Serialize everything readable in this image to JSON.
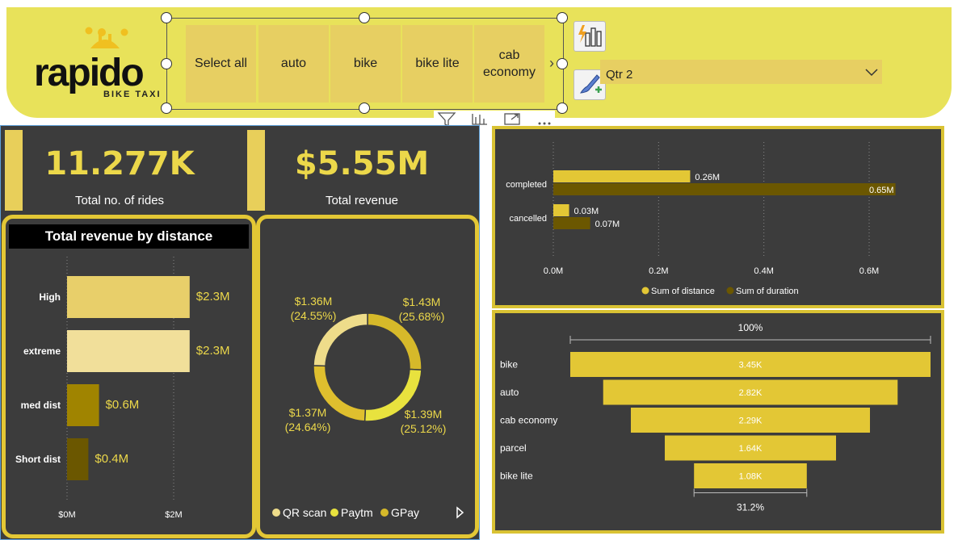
{
  "header": {
    "logo_text": "rapido",
    "logo_sub": "BIKE TAXI",
    "slicer_items": [
      "Select all",
      "auto",
      "bike",
      "bike lite",
      "cab economy"
    ],
    "quarter": "Qtr 2",
    "colors": {
      "header_bg": "#e8e25a",
      "tile": "#e7cf62"
    },
    "icons": [
      "quick-insights-icon",
      "format-painter-icon",
      "filter-icon",
      "focus-mode-icon",
      "expand-icon",
      "more-options-icon",
      "chevron-down-icon"
    ]
  },
  "cards": {
    "rides_value": "11.277K",
    "rides_label": "Total no. of rides",
    "revenue_value": "$5.55M",
    "revenue_label": "Total revenue"
  },
  "revenue_by_distance_title": "Total revenue by distance",
  "donut_legend": [
    "QR scan",
    "Paytm",
    "GPay"
  ],
  "chart_data": [
    {
      "type": "bar",
      "orientation": "horizontal",
      "title": "Total revenue by distance",
      "categories": [
        "High",
        "extreme",
        "med dist",
        "Short dist"
      ],
      "values": [
        2.3,
        2.3,
        0.6,
        0.4
      ],
      "value_labels": [
        "$2.3M",
        "$2.3M",
        "$0.6M",
        "$0.4M"
      ],
      "bar_colors": [
        "#e8cf6a",
        "#f1df9a",
        "#a08400",
        "#6b5700"
      ],
      "x_ticks": [
        "$0M",
        "$2M"
      ],
      "xlim": [
        0,
        2.6
      ],
      "grid": true
    },
    {
      "type": "pie",
      "donut": true,
      "labels": [
        "QR scan",
        "Paytm",
        "GPay"
      ],
      "segments": [
        {
          "value": 1.43,
          "label": "$1.43M",
          "pct": "(25.68%)",
          "color": "#d6b92a"
        },
        {
          "value": 1.39,
          "label": "$1.39M",
          "pct": "(25.12%)",
          "color": "#e8e23e"
        },
        {
          "value": 1.37,
          "label": "$1.37M",
          "pct": "(24.64%)",
          "color": "#dfbf2e"
        },
        {
          "value": 1.36,
          "label": "$1.36M",
          "pct": "(24.55%)",
          "color": "#eedc8a"
        }
      ],
      "legend": [
        {
          "name": "QR scan",
          "color": "#eedc8a"
        },
        {
          "name": "Paytm",
          "color": "#e8e23e"
        },
        {
          "name": "GPay",
          "color": "#d6b92a"
        }
      ],
      "legend_position": "bottom"
    },
    {
      "type": "bar",
      "orientation": "horizontal",
      "grouped": true,
      "categories": [
        "completed",
        "cancelled"
      ],
      "series": [
        {
          "name": "Sum of distance",
          "values": [
            0.26,
            0.03
          ],
          "labels": [
            "0.26M",
            "0.03M"
          ],
          "color": "#e3c735"
        },
        {
          "name": "Sum of duration",
          "values": [
            0.65,
            0.07
          ],
          "labels": [
            "0.65M",
            "0.07M"
          ],
          "color": "#6b5700"
        }
      ],
      "x_ticks": [
        "0.0M",
        "0.2M",
        "0.4M",
        "0.6M"
      ],
      "x_tick_values": [
        0,
        0.2,
        0.4,
        0.6
      ],
      "xlim": [
        0,
        0.65
      ],
      "grid": true,
      "legend_position": "bottom"
    },
    {
      "type": "funnel",
      "categories": [
        "bike",
        "auto",
        "cab economy",
        "parcel",
        "bike lite"
      ],
      "values": [
        3.45,
        2.82,
        2.29,
        1.64,
        1.08
      ],
      "value_labels": [
        "3.45K",
        "2.82K",
        "2.29K",
        "1.64K",
        "1.08K"
      ],
      "top_pct": "100%",
      "bottom_pct": "31.2%",
      "color": "#e3c735"
    }
  ]
}
